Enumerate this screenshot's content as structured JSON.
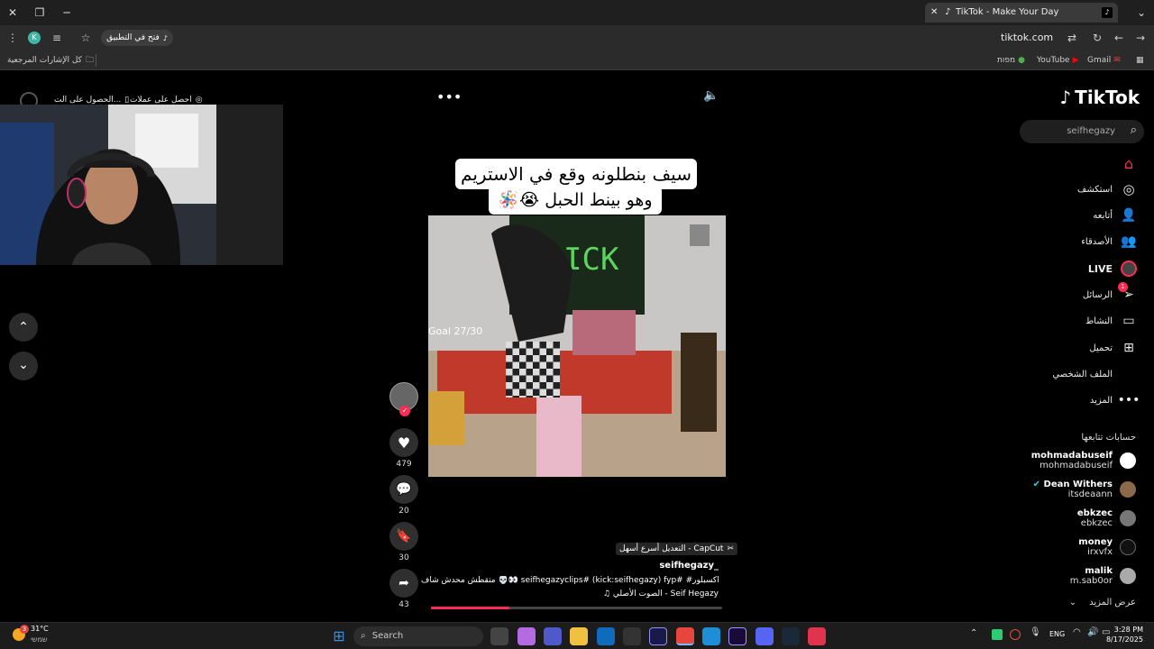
{
  "browser": {
    "tab_title": "TikTok - Make Your Day",
    "url": "tiktok.com",
    "open_in_app": "فتح في التطبيق",
    "profile_initial": "K",
    "bookmarks": [
      {
        "label": "Gmail",
        "icon": "gmail-icon"
      },
      {
        "label": "YouTube",
        "icon": "youtube-icon"
      },
      {
        "label": "מפות",
        "icon": "maps-icon"
      }
    ],
    "all_bookmarks": "كل الإشارات المرجعية"
  },
  "tiktok": {
    "logo": "TikTok",
    "search_placeholder": "seifhegazy",
    "nav": [
      {
        "label": "",
        "icon": "home-icon",
        "active": true
      },
      {
        "label": "استكشف",
        "icon": "compass-icon"
      },
      {
        "label": "أتابعه",
        "icon": "user-plus-icon"
      },
      {
        "label": "الأصدقاء",
        "icon": "friends-icon"
      },
      {
        "label": "LIVE",
        "icon": "live-icon"
      },
      {
        "label": "الرسائل",
        "icon": "send-icon",
        "badge": "1"
      },
      {
        "label": "النشاط",
        "icon": "chat-icon"
      },
      {
        "label": "تحميل",
        "icon": "plus-box-icon"
      },
      {
        "label": "الملف الشخصي",
        "icon": "profile-icon"
      },
      {
        "label": "المزيد",
        "icon": "more-icon"
      }
    ],
    "following_title": "حسابات تتابعها",
    "following": [
      {
        "name": "mohmadabuseif",
        "handle": "mohmadabuseif",
        "verified": false
      },
      {
        "name": "Dean Withers",
        "handle": "itsdeaann",
        "verified": true
      },
      {
        "name": "ebkzec",
        "handle": "ebkzec",
        "verified": false
      },
      {
        "name": "money",
        "handle": "irxvfx",
        "verified": false
      },
      {
        "name": "malik",
        "handle": "m.sab0or",
        "verified": false
      }
    ],
    "show_more": "عرض المزيد",
    "get_coins": "احصل على عملات",
    "get_app": "الحصول على الت..."
  },
  "video": {
    "caption_line1": "سيف بنطلونه وقع في الاستريم",
    "caption_line2": "وهو بينط الحبل 😭🪅",
    "goal_text": "Goal 27/30",
    "capcut_label": "CapCut - التعديل أسرع أسهل",
    "author": "seifhegazy_",
    "description": "متقطش محدش شاف 💀👀 seifhegazyclips# (kick:seifhegazy) fyp# #اكسبلور",
    "sound": "♫ الصوت الأصلي - Seif Hegazy",
    "progress": 0.27
  },
  "actions": {
    "likes": "479",
    "comments": "20",
    "saves": "30",
    "shares": "43"
  },
  "taskbar": {
    "weather_temp": "31°C",
    "weather_desc": "שמשי",
    "weather_badge": "3",
    "search_placeholder": "Search",
    "lang": "ENG",
    "time": "3:28 PM",
    "date": "8/17/2025"
  }
}
